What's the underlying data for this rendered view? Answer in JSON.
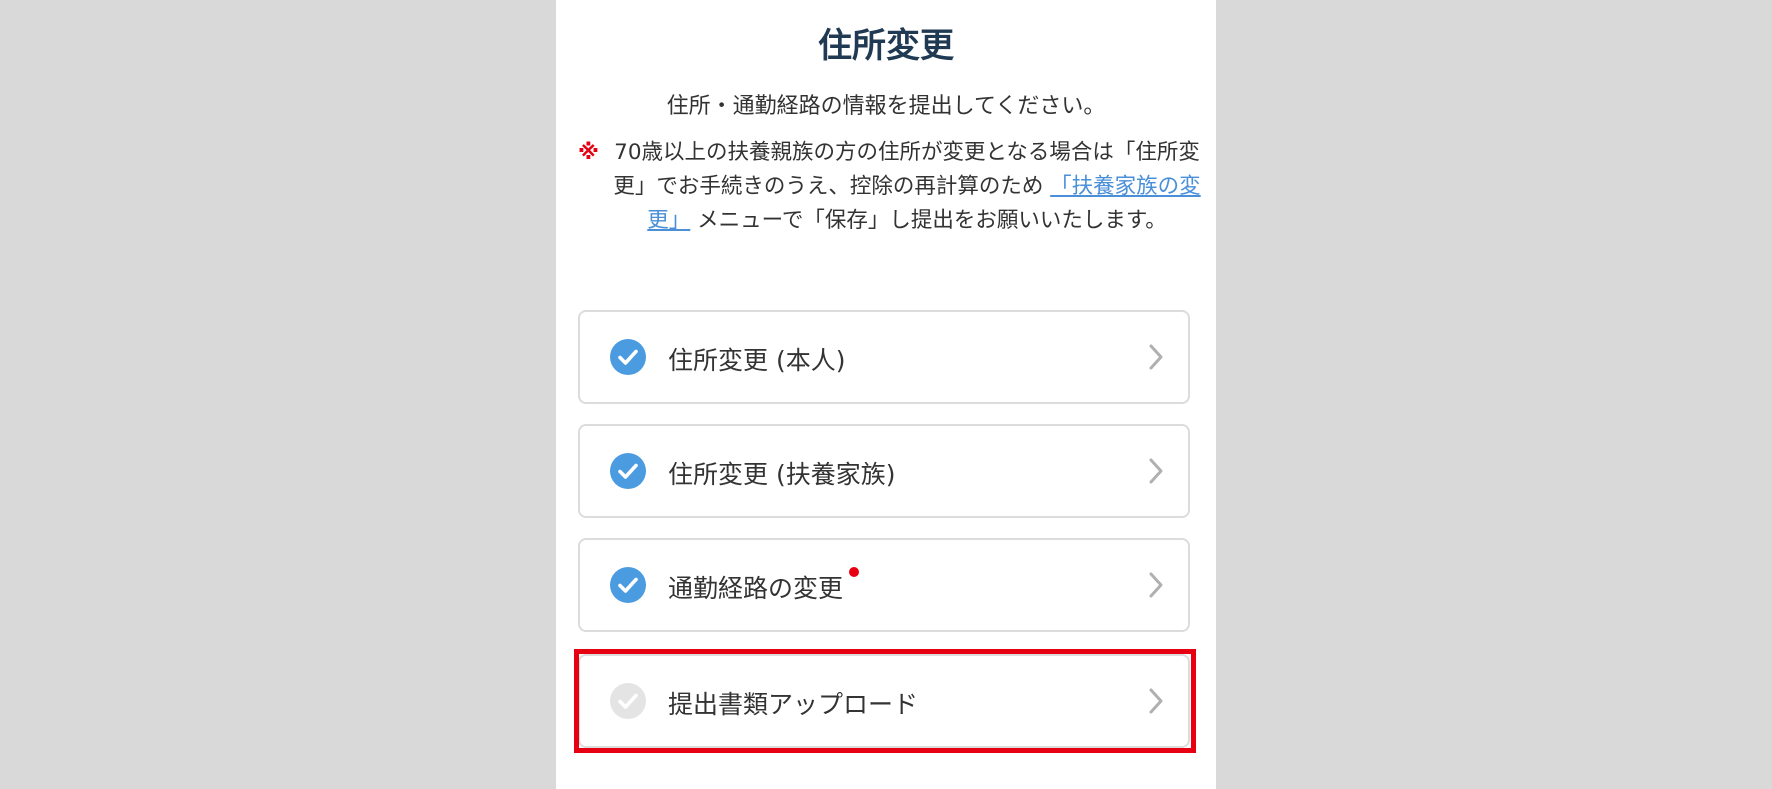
{
  "page": {
    "title": "住所変更",
    "subtitle": "住所・通勤経路の情報を提出してください。"
  },
  "notice": {
    "mark": "※",
    "text_before_link": "70歳以上の扶養親族の方の住所が変更となる場合は「住所変更」でお手続きのうえ、控除の再計算のため",
    "link_text": "「扶養家族の変更」",
    "text_after_link": "メニューで「保存」し提出をお願いいたします。"
  },
  "menu": {
    "items": [
      {
        "label": "住所変更 (本人)",
        "checked": true,
        "icon": "check-circle-icon"
      },
      {
        "label": "住所変更 (扶養家族)",
        "checked": true,
        "icon": "check-circle-icon"
      },
      {
        "label": "通勤経路の変更",
        "checked": true,
        "icon": "check-circle-icon",
        "required_dot": true
      },
      {
        "label": "提出書類アップロード",
        "checked": false,
        "icon": "check-circle-icon",
        "highlighted": true
      }
    ]
  },
  "colors": {
    "accent": "#4a9be0",
    "title": "#1f3a52",
    "alert": "#e60012",
    "link": "#4a8fd8",
    "background": "#d9d9d9",
    "unchecked": "#e4e4e4"
  }
}
